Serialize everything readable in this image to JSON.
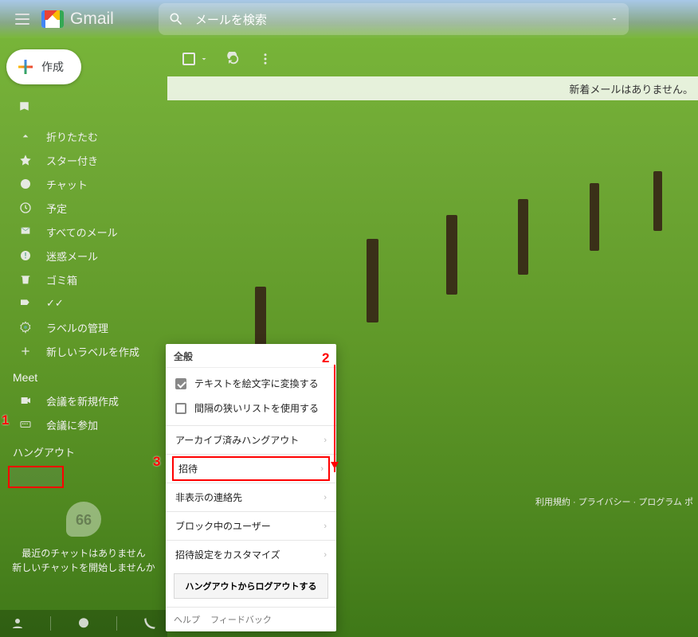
{
  "header": {
    "logo_text": "Gmail",
    "search_placeholder": "メールを検索"
  },
  "compose": {
    "label": "作成"
  },
  "sidebar": {
    "items": [
      {
        "label": "折りたたむ",
        "icon": "chevron-up"
      },
      {
        "label": "スター付き",
        "icon": "star"
      },
      {
        "label": "チャット",
        "icon": "chat-bubble"
      },
      {
        "label": "予定",
        "icon": "clock"
      },
      {
        "label": "すべてのメール",
        "icon": "mail-stack"
      },
      {
        "label": "迷惑メール",
        "icon": "warning"
      },
      {
        "label": "ゴミ箱",
        "icon": "trash"
      },
      {
        "label": "✓✓",
        "icon": "label"
      },
      {
        "label": "ラベルの管理",
        "icon": "gear"
      },
      {
        "label": "新しいラベルを作成",
        "icon": "plus"
      }
    ],
    "meet_header": "Meet",
    "meet": [
      {
        "label": "会議を新規作成",
        "icon": "video"
      },
      {
        "label": "会議に参加",
        "icon": "keyboard"
      }
    ],
    "hangout_header": "ハングアウト"
  },
  "inbox": {
    "empty_message": "新着メールはありません。"
  },
  "hangout_empty": {
    "line1": "最近のチャットはありません",
    "line2": "新しいチャットを開始しませんか"
  },
  "footer": {
    "terms": "利用規約",
    "privacy": "プライバシー",
    "program": "プログラム ポ"
  },
  "popup": {
    "header": "全般",
    "opt_emoji": "テキストを絵文字に変換する",
    "opt_dense": "間隔の狭いリストを使用する",
    "items": [
      "アーカイブ済みハングアウト",
      "招待",
      "非表示の連絡先",
      "ブロック中のユーザー",
      "招待設定をカスタマイズ"
    ],
    "logout": "ハングアウトからログアウトする",
    "help": "ヘルプ",
    "feedback": "フィードバック"
  },
  "annotations": {
    "n1": "1",
    "n2": "2",
    "n3": "3"
  }
}
